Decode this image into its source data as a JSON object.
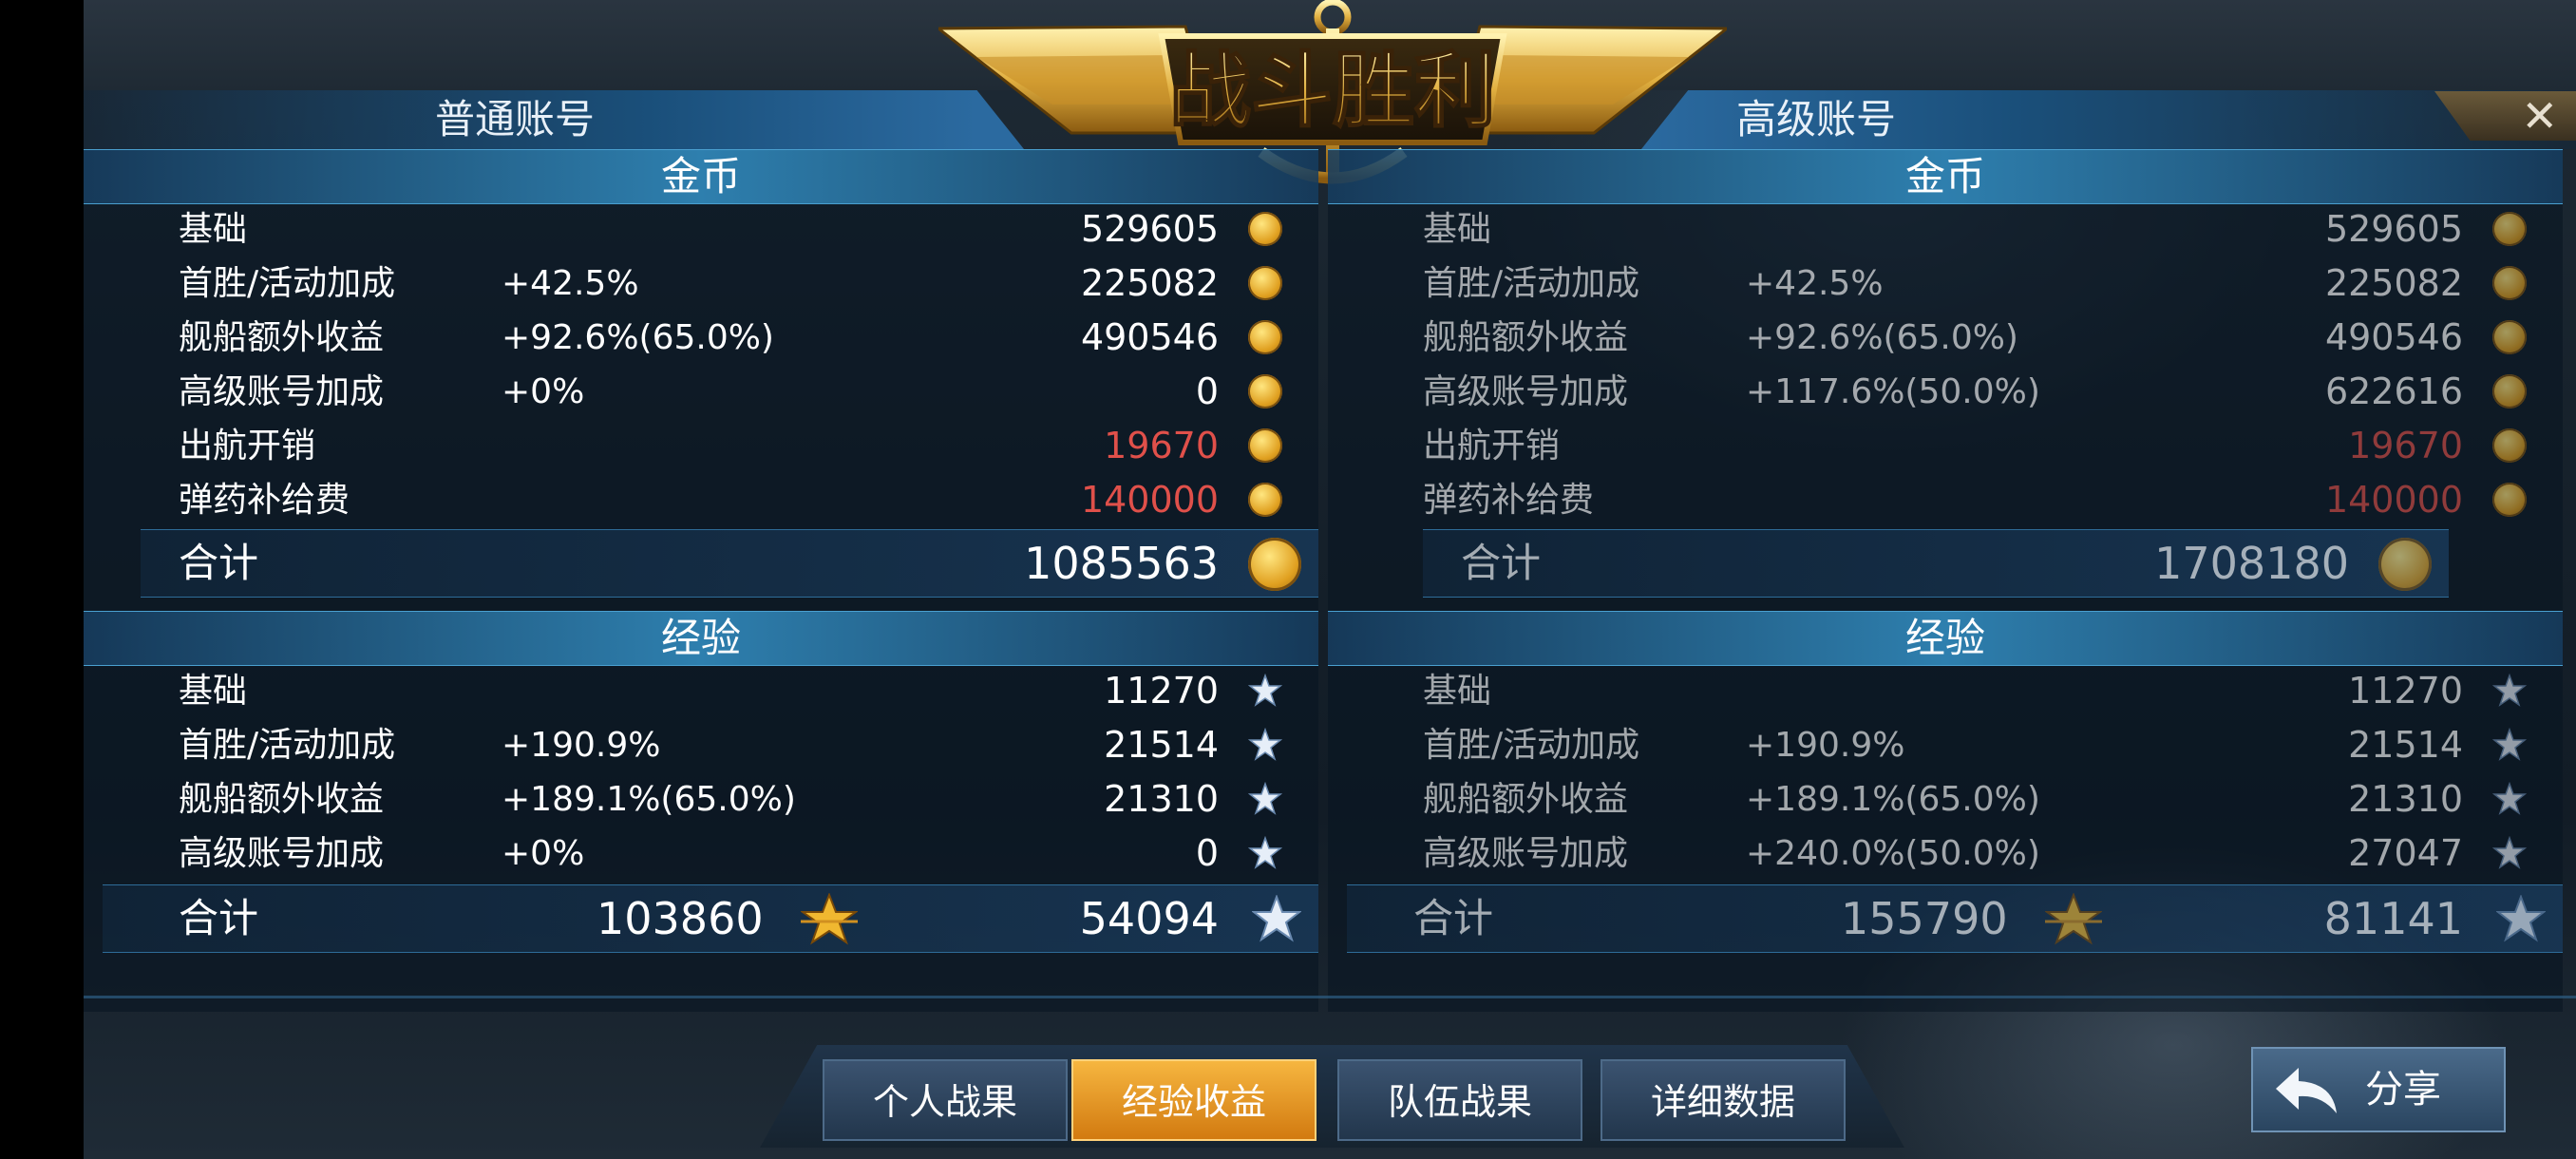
{
  "title": "战斗胜利",
  "close_symbol": "✕",
  "left": {
    "header": "普通账号",
    "gold": {
      "title": "金币",
      "rows": [
        {
          "label": "基础",
          "pct": "",
          "value": "529605",
          "negative": false
        },
        {
          "label": "首胜/活动加成",
          "pct": "+42.5%",
          "value": "225082",
          "negative": false
        },
        {
          "label": "舰船额外收益",
          "pct": "+92.6%(65.0%)",
          "value": "490546",
          "negative": false
        },
        {
          "label": "高级账号加成",
          "pct": "+0%",
          "value": "0",
          "negative": false
        },
        {
          "label": "出航开销",
          "pct": "",
          "value": "19670",
          "negative": true
        },
        {
          "label": "弹药补给费",
          "pct": "",
          "value": "140000",
          "negative": true
        }
      ],
      "total_label": "合计",
      "total": "1085563"
    },
    "exp": {
      "title": "经验",
      "rows": [
        {
          "label": "基础",
          "pct": "",
          "value": "11270"
        },
        {
          "label": "首胜/活动加成",
          "pct": "+190.9%",
          "value": "21514"
        },
        {
          "label": "舰船额外收益",
          "pct": "+189.1%(65.0%)",
          "value": "21310"
        },
        {
          "label": "高级账号加成",
          "pct": "+0%",
          "value": "0"
        }
      ],
      "total_label": "合计",
      "total_gold_star": "103860",
      "total_silver_star": "54094"
    }
  },
  "right": {
    "header": "高级账号",
    "gold": {
      "title": "金币",
      "rows": [
        {
          "label": "基础",
          "pct": "",
          "value": "529605",
          "negative": false
        },
        {
          "label": "首胜/活动加成",
          "pct": "+42.5%",
          "value": "225082",
          "negative": false
        },
        {
          "label": "舰船额外收益",
          "pct": "+92.6%(65.0%)",
          "value": "490546",
          "negative": false
        },
        {
          "label": "高级账号加成",
          "pct": "+117.6%(50.0%)",
          "value": "622616",
          "negative": false
        },
        {
          "label": "出航开销",
          "pct": "",
          "value": "19670",
          "negative": true
        },
        {
          "label": "弹药补给费",
          "pct": "",
          "value": "140000",
          "negative": true
        }
      ],
      "total_label": "合计",
      "total": "1708180"
    },
    "exp": {
      "title": "经验",
      "rows": [
        {
          "label": "基础",
          "pct": "",
          "value": "11270"
        },
        {
          "label": "首胜/活动加成",
          "pct": "+190.9%",
          "value": "21514"
        },
        {
          "label": "舰船额外收益",
          "pct": "+189.1%(65.0%)",
          "value": "21310"
        },
        {
          "label": "高级账号加成",
          "pct": "+240.0%(50.0%)",
          "value": "27047"
        }
      ],
      "total_label": "合计",
      "total_gold_star": "155790",
      "total_silver_star": "81141"
    }
  },
  "tabs": [
    {
      "label": "个人战果",
      "active": false
    },
    {
      "label": "经验收益",
      "active": true
    },
    {
      "label": "队伍战果",
      "active": false
    },
    {
      "label": "详细数据",
      "active": false
    }
  ],
  "share_label": "分享",
  "colors": {
    "negative": "#e0504a",
    "tab_active": "#f0a030",
    "section_header": "#2e7fae"
  },
  "icons": {
    "gold": "coin-icon",
    "exp": "silver-star-icon",
    "exp_total": "gold-star-icon",
    "close": "close-icon",
    "share": "share-arrow-icon"
  }
}
